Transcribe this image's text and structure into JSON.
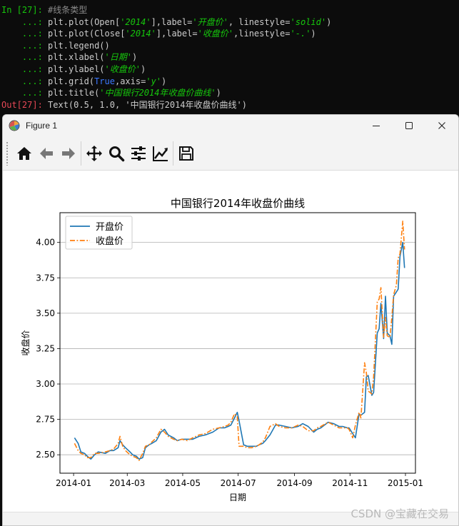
{
  "terminal": {
    "in_prompt": "In [27]:",
    "cont_prompt": "...:",
    "out_prompt": "Out[27]:",
    "comment": "#线条类型",
    "line1": {
      "a": "plt.plot(Open[",
      "s1": "'2014'",
      "b": "],label=",
      "s2": "'开盘价'",
      "c": ", linestyle=",
      "s3": "'solid'",
      "d": ")"
    },
    "line2": {
      "a": "plt.plot(Close[",
      "s1": "'2014'",
      "b": "],label=",
      "s2": "'收盘价'",
      "c": ",linestyle=",
      "s3": "'-.'",
      "d": ")"
    },
    "line3": "plt.legend()",
    "line4": {
      "a": "plt.xlabel(",
      "s1": "'日期'",
      "b": ")"
    },
    "line5": {
      "a": "plt.ylabel(",
      "s1": "'收盘价'",
      "b": ")"
    },
    "line6": {
      "a": "plt.grid(",
      "kw": "True",
      "b": ",axis=",
      "s1": "'y'",
      "c": ")"
    },
    "line7": {
      "a": "plt.title(",
      "s1": "'中国银行2014年收盘价曲线'",
      "b": ")"
    },
    "out_text": "Text(0.5, 1.0, '中国银行2014年收盘价曲线')"
  },
  "window": {
    "title": "Figure 1",
    "icons": [
      "app-icon",
      "minimize-icon",
      "maximize-icon",
      "close-icon"
    ]
  },
  "toolbar": {
    "icons": [
      "home-icon",
      "back-arrow-icon",
      "forward-arrow-icon",
      "pan-icon",
      "zoom-icon",
      "configure-subplots-icon",
      "edit-axis-icon",
      "save-icon"
    ]
  },
  "watermark": "CSDN @宝藏在交易",
  "chart_data": {
    "type": "line",
    "title": "中国银行2014年收盘价曲线",
    "xlabel": "日期",
    "ylabel": "收盘价",
    "grid": "y-axis",
    "legend_position": "top-left",
    "x_ticks": [
      "2014-01",
      "2014-03",
      "2014-05",
      "2014-07",
      "2014-09",
      "2014-11",
      "2015-01"
    ],
    "y_ticks": [
      "2.50",
      "2.75",
      "3.00",
      "3.25",
      "3.50",
      "3.75",
      "4.00"
    ],
    "xlim": [
      "2013-12-17",
      "2015-01-12"
    ],
    "ylim": [
      2.37,
      4.21
    ],
    "colors": {
      "open": "#1f77b4",
      "close": "#ff7f0e",
      "grid": "#b0b0b0"
    },
    "x": [
      "2014-01-02",
      "2014-01-06",
      "2014-01-09",
      "2014-01-13",
      "2014-01-16",
      "2014-01-20",
      "2014-01-24",
      "2014-01-28",
      "2014-02-05",
      "2014-02-10",
      "2014-02-14",
      "2014-02-19",
      "2014-02-21",
      "2014-02-24",
      "2014-02-27",
      "2014-03-04",
      "2014-03-07",
      "2014-03-11",
      "2014-03-14",
      "2014-03-18",
      "2014-03-21",
      "2014-03-25",
      "2014-03-28",
      "2014-04-02",
      "2014-04-07",
      "2014-04-11",
      "2014-04-15",
      "2014-04-21",
      "2014-04-25",
      "2014-04-30",
      "2014-05-06",
      "2014-05-12",
      "2014-05-19",
      "2014-05-26",
      "2014-06-03",
      "2014-06-10",
      "2014-06-16",
      "2014-06-20",
      "2014-06-23",
      "2014-06-27",
      "2014-06-30",
      "2014-07-02",
      "2014-07-07",
      "2014-07-11",
      "2014-07-16",
      "2014-07-21",
      "2014-07-24",
      "2014-07-28",
      "2014-07-31",
      "2014-08-05",
      "2014-08-11",
      "2014-08-15",
      "2014-08-22",
      "2014-08-29",
      "2014-09-05",
      "2014-09-10",
      "2014-09-16",
      "2014-09-22",
      "2014-09-26",
      "2014-09-30",
      "2014-10-08",
      "2014-10-14",
      "2014-10-20",
      "2014-10-24",
      "2014-10-29",
      "2014-10-31",
      "2014-11-04",
      "2014-11-07",
      "2014-11-11",
      "2014-11-13",
      "2014-11-17",
      "2014-11-19",
      "2014-11-21",
      "2014-11-25",
      "2014-11-27",
      "2014-12-01",
      "2014-12-03",
      "2014-12-05",
      "2014-12-08",
      "2014-12-10",
      "2014-12-12",
      "2014-12-15",
      "2014-12-17",
      "2014-12-19",
      "2014-12-22",
      "2014-12-24",
      "2014-12-26",
      "2014-12-29",
      "2014-12-31"
    ],
    "series": [
      {
        "name": "开盘价",
        "style": "solid",
        "values": [
          2.62,
          2.58,
          2.52,
          2.51,
          2.49,
          2.47,
          2.5,
          2.52,
          2.51,
          2.53,
          2.53,
          2.55,
          2.6,
          2.57,
          2.55,
          2.52,
          2.5,
          2.49,
          2.47,
          2.48,
          2.55,
          2.57,
          2.58,
          2.6,
          2.66,
          2.68,
          2.64,
          2.62,
          2.6,
          2.61,
          2.61,
          2.61,
          2.63,
          2.64,
          2.66,
          2.69,
          2.69,
          2.7,
          2.71,
          2.76,
          2.8,
          2.74,
          2.57,
          2.56,
          2.56,
          2.56,
          2.57,
          2.58,
          2.6,
          2.64,
          2.71,
          2.71,
          2.7,
          2.69,
          2.7,
          2.72,
          2.7,
          2.66,
          2.68,
          2.69,
          2.73,
          2.72,
          2.7,
          2.7,
          2.69,
          2.69,
          2.65,
          2.62,
          2.79,
          2.78,
          2.8,
          3.05,
          3.06,
          2.92,
          2.94,
          3.36,
          3.39,
          3.57,
          3.32,
          3.62,
          3.36,
          3.34,
          3.28,
          3.62,
          3.65,
          3.67,
          3.9,
          4.0,
          3.82
        ]
      },
      {
        "name": "收盘价",
        "style": "dashdot",
        "values": [
          2.58,
          2.53,
          2.51,
          2.5,
          2.48,
          2.48,
          2.51,
          2.51,
          2.52,
          2.53,
          2.54,
          2.58,
          2.63,
          2.56,
          2.53,
          2.5,
          2.49,
          2.48,
          2.46,
          2.51,
          2.56,
          2.57,
          2.59,
          2.62,
          2.68,
          2.66,
          2.63,
          2.61,
          2.6,
          2.61,
          2.6,
          2.62,
          2.64,
          2.65,
          2.68,
          2.69,
          2.7,
          2.71,
          2.73,
          2.79,
          2.77,
          2.56,
          2.56,
          2.55,
          2.55,
          2.56,
          2.57,
          2.59,
          2.62,
          2.7,
          2.72,
          2.7,
          2.69,
          2.69,
          2.71,
          2.7,
          2.67,
          2.67,
          2.69,
          2.7,
          2.73,
          2.71,
          2.69,
          2.69,
          2.69,
          2.68,
          2.62,
          2.71,
          2.8,
          2.76,
          3.15,
          3.08,
          2.95,
          2.93,
          3.05,
          3.58,
          3.6,
          3.68,
          3.33,
          3.47,
          3.34,
          3.33,
          3.47,
          3.63,
          3.7,
          3.89,
          3.92,
          4.15,
          3.95
        ]
      }
    ]
  }
}
